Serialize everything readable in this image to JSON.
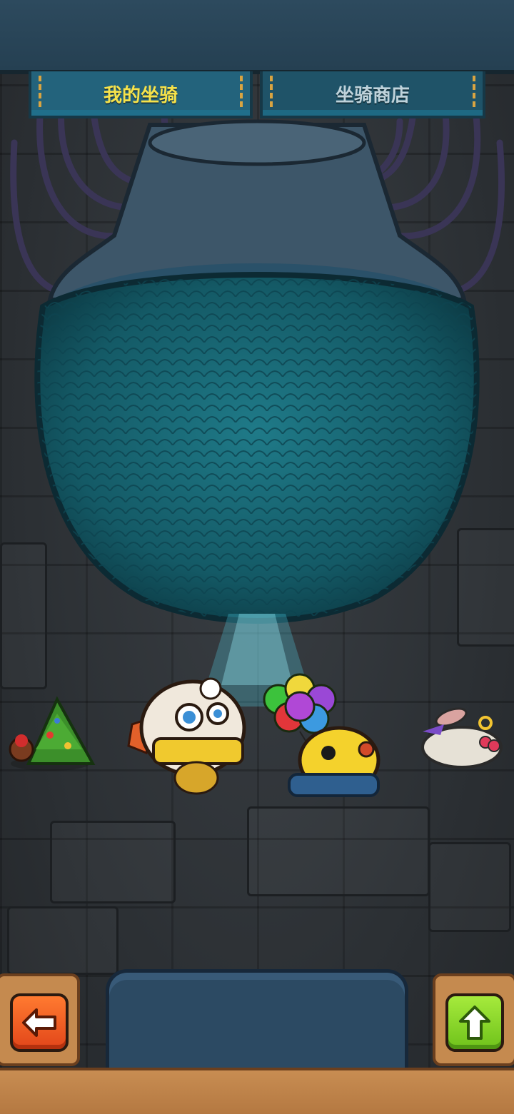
{
  "tabs": {
    "my_mounts": "我的坐骑",
    "mount_shop": "坐骑商店"
  },
  "mounts": [
    {
      "id": "christmas-tree-snail",
      "icon": "christmas-tree-mount-icon"
    },
    {
      "id": "lion-dance",
      "icon": "lion-dance-mount-icon"
    },
    {
      "id": "balloon-chick",
      "icon": "balloon-chick-mount-icon"
    },
    {
      "id": "white-rabbit",
      "icon": "white-rabbit-mount-icon"
    }
  ],
  "buttons": {
    "back_icon": "arrow-left-icon",
    "upgrade_icon": "arrow-up-icon"
  },
  "colors": {
    "active_tab_text": "#f6e24a",
    "inactive_tab_text": "#bfd3db",
    "back_button": "#ff6a26",
    "upgrade_button": "#8ed62a"
  }
}
